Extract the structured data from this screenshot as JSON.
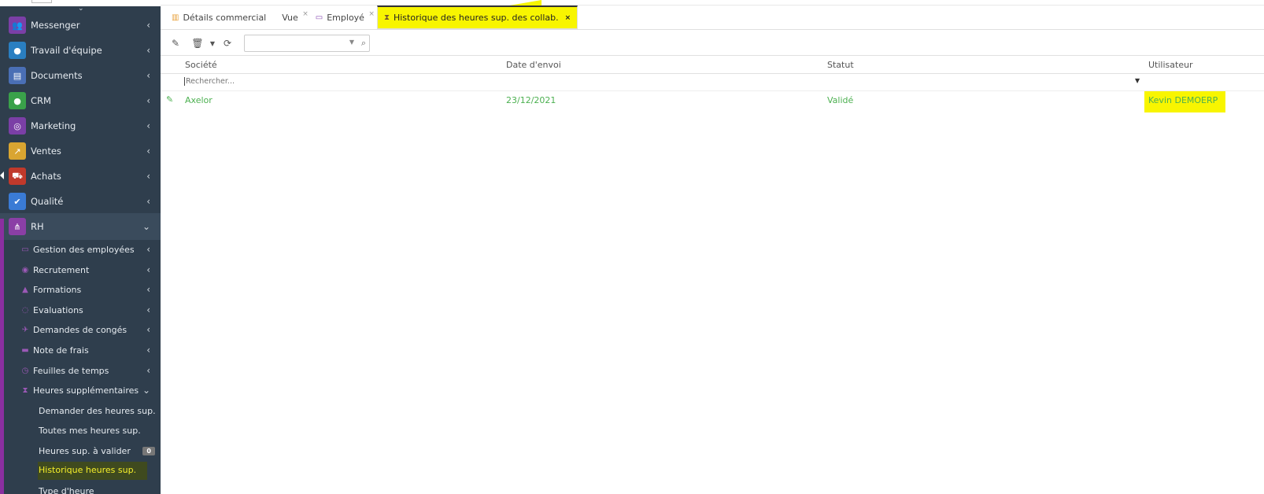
{
  "sidebar": {
    "menu": [
      {
        "label": "Messenger",
        "icon": "users-icon",
        "color": "#7b3fa6"
      },
      {
        "label": "Travail d'équipe",
        "icon": "user-icon",
        "color": "#2a7fc1"
      },
      {
        "label": "Documents",
        "icon": "archive-icon",
        "color": "#4a6fb5"
      },
      {
        "label": "CRM",
        "icon": "user-icon",
        "color": "#3aa14a"
      },
      {
        "label": "Marketing",
        "icon": "bullseye-icon",
        "color": "#7b3fa6"
      },
      {
        "label": "Ventes",
        "icon": "chart-line-icon",
        "color": "#d9a531"
      },
      {
        "label": "Achats",
        "icon": "cart-icon",
        "color": "#c0392b"
      },
      {
        "label": "Qualité",
        "icon": "check-icon",
        "color": "#3a7bd5"
      }
    ],
    "rh": {
      "label": "RH",
      "icon": "sitemap-icon",
      "color": "#8b3fa6"
    },
    "sub_items": [
      {
        "label": "Gestion des employées",
        "icon": "id-card-icon"
      },
      {
        "label": "Recrutement",
        "icon": "eye-icon"
      },
      {
        "label": "Formations",
        "icon": "graduation-cap-icon"
      },
      {
        "label": "Evaluations",
        "icon": "comments-icon"
      },
      {
        "label": "Demandes de congés",
        "icon": "plane-icon"
      },
      {
        "label": "Note de frais",
        "icon": "credit-card-icon"
      },
      {
        "label": "Feuilles de temps",
        "icon": "clock-icon"
      },
      {
        "label": "Heures supplémentaires",
        "icon": "hourglass-icon"
      }
    ],
    "leaves": [
      {
        "label": "Demander des heures sup."
      },
      {
        "label": "Toutes mes heures sup."
      },
      {
        "label": "Heures sup. à valider",
        "badge": "0"
      },
      {
        "label": "Historique heures sup.",
        "active": true
      },
      {
        "label": "Type d'heure"
      }
    ]
  },
  "tabs": [
    {
      "label": "Détails commercial",
      "icon": "bar-chart-icon",
      "closable": false
    },
    {
      "label": "Vue",
      "closable": true
    },
    {
      "label": "Employé",
      "icon": "id-card-icon",
      "closable": true
    },
    {
      "label": "Historique des heures sup. des collab.",
      "icon": "hourglass-icon",
      "active": true,
      "closable": true
    }
  ],
  "tab_close_glyph": "×",
  "search": {
    "value": "",
    "placeholder": ""
  },
  "grid": {
    "columns": [
      "Société",
      "Date d'envoi",
      "Statut",
      "Utilisateur"
    ],
    "filter_placeholder": "Rechercher...",
    "rows": [
      {
        "societe": "Axelor",
        "date_envoi": "23/12/2021",
        "statut": "Validé",
        "utilisateur": "Kevin DEMOERP"
      }
    ]
  },
  "colors": {
    "sidebar_bg": "#2f3e4d",
    "highlight": "#f8f500",
    "row_text": "#4cb050",
    "accent": "#8b2fa0"
  }
}
